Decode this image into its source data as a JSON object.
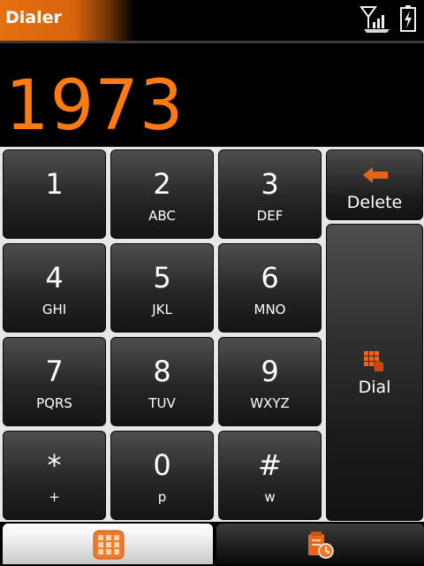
{
  "app": {
    "title": "Dialer"
  },
  "status": {
    "signal_icon": "signal-icon",
    "battery_icon": "battery-charging-icon"
  },
  "display": {
    "number": "1973"
  },
  "keys": [
    {
      "digit": "1",
      "letters": ""
    },
    {
      "digit": "2",
      "letters": "ABC"
    },
    {
      "digit": "3",
      "letters": "DEF"
    },
    {
      "digit": "4",
      "letters": "GHI"
    },
    {
      "digit": "5",
      "letters": "JKL"
    },
    {
      "digit": "6",
      "letters": "MNO"
    },
    {
      "digit": "7",
      "letters": "PQRS"
    },
    {
      "digit": "8",
      "letters": "TUV"
    },
    {
      "digit": "9",
      "letters": "WXYZ"
    },
    {
      "digit": "*",
      "letters": "+"
    },
    {
      "digit": "0",
      "letters": "p"
    },
    {
      "digit": "#",
      "letters": "w"
    }
  ],
  "actions": {
    "delete_label": "Delete",
    "dial_label": "Dial"
  },
  "tabs": [
    {
      "icon": "keypad-icon",
      "active": true
    },
    {
      "icon": "call-history-icon",
      "active": false
    }
  ],
  "colors": {
    "accent": "#ff7a10",
    "key_bg": "#2a2a2a",
    "keypad_bg": "#e7e7e7"
  }
}
